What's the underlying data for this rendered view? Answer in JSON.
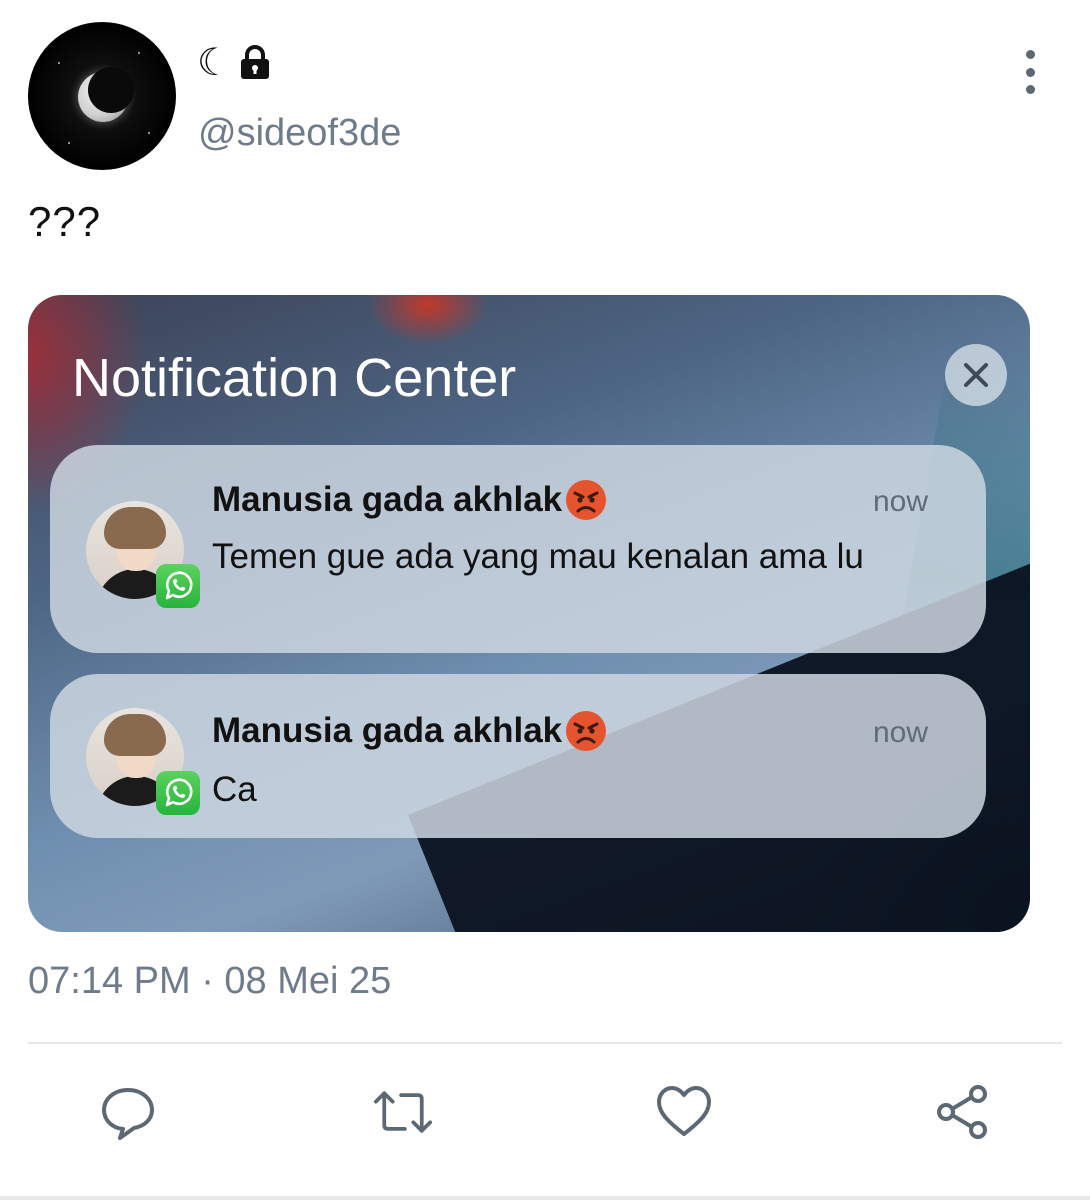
{
  "header": {
    "display_name_glyph": "☾",
    "handle": "@sideof3de"
  },
  "tweet": {
    "text": "???",
    "timestamp": "07:14 PM · 08 Mei 25"
  },
  "media": {
    "title": "Notification Center",
    "notifications": [
      {
        "sender": "Manusia gada akhlak",
        "sender_emoji": "angry-face-icon",
        "time": "now",
        "message": "Temen gue ada yang mau kenalan ama lu",
        "app": "whatsapp-icon"
      },
      {
        "sender": "Manusia gada akhlak",
        "sender_emoji": "angry-face-icon",
        "time": "now",
        "message": "Ca",
        "app": "whatsapp-icon"
      }
    ]
  },
  "actions": [
    "reply-icon",
    "retweet-icon",
    "like-icon",
    "share-icon"
  ],
  "colors": {
    "handle": "#6e7b8a",
    "whatsapp": "#27b43c",
    "angry": "#e5532f"
  }
}
